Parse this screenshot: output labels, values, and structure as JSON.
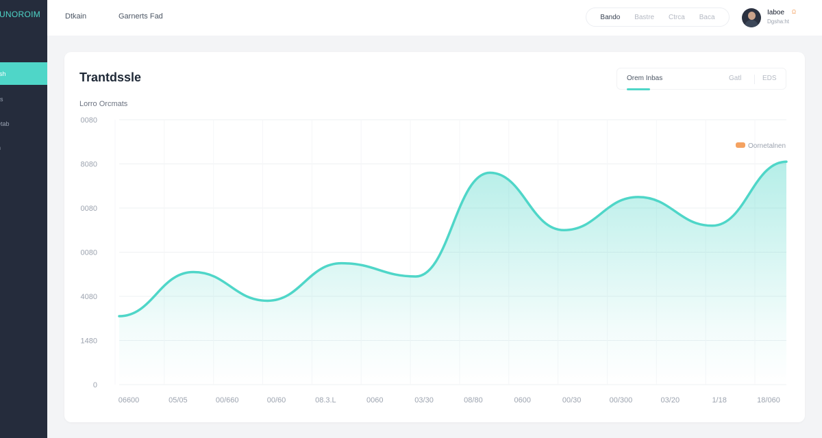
{
  "sidebar": {
    "brand": "NUNOROIM",
    "items": [
      {
        "label": "ash",
        "active": true
      },
      {
        "label": "ills",
        "active": false
      },
      {
        "label": "letab",
        "active": false
      },
      {
        "label": "in",
        "active": false
      }
    ]
  },
  "topbar": {
    "links": [
      "Dtkain",
      "Garnerts Fad"
    ],
    "segments": [
      {
        "label": "Bando",
        "active": true
      },
      {
        "label": "Bastre",
        "active": false
      },
      {
        "label": "Ctrca",
        "active": false
      },
      {
        "label": "Baca",
        "active": false
      }
    ],
    "user": {
      "name": "Iaboe",
      "sub": "Dgsha:ht",
      "badge": "Ω"
    }
  },
  "card": {
    "title": "Trantdssle",
    "subtitle": "Lorro Orcmats",
    "tabs": [
      {
        "label": "Orem Inbas",
        "active": true
      },
      {
        "label": "Gatl",
        "active": false
      },
      {
        "label": "EDS",
        "active": false
      }
    ]
  },
  "colors": {
    "accent": "#4fd6c8",
    "sidebar": "#252c3c",
    "legend_swatch": "#f4a261"
  },
  "chart_data": {
    "type": "area",
    "y_ticks": [
      "0080",
      "8080",
      "0080",
      "0080",
      "4080",
      "1480",
      "0"
    ],
    "x_labels": [
      "06600",
      "05/05",
      "00/660",
      "00/60",
      "08.3.L",
      "0060",
      "03/30",
      "08/80",
      "0600",
      "00/30",
      "00/300",
      "03/20",
      "1/18",
      "18/060"
    ],
    "legend": [
      "Oornetalnen"
    ],
    "ylim": [
      0,
      6
    ],
    "values": [
      1.55,
      2.55,
      1.9,
      2.75,
      2.45,
      4.8,
      3.5,
      4.25,
      3.6,
      5.05
    ],
    "grid": true
  }
}
